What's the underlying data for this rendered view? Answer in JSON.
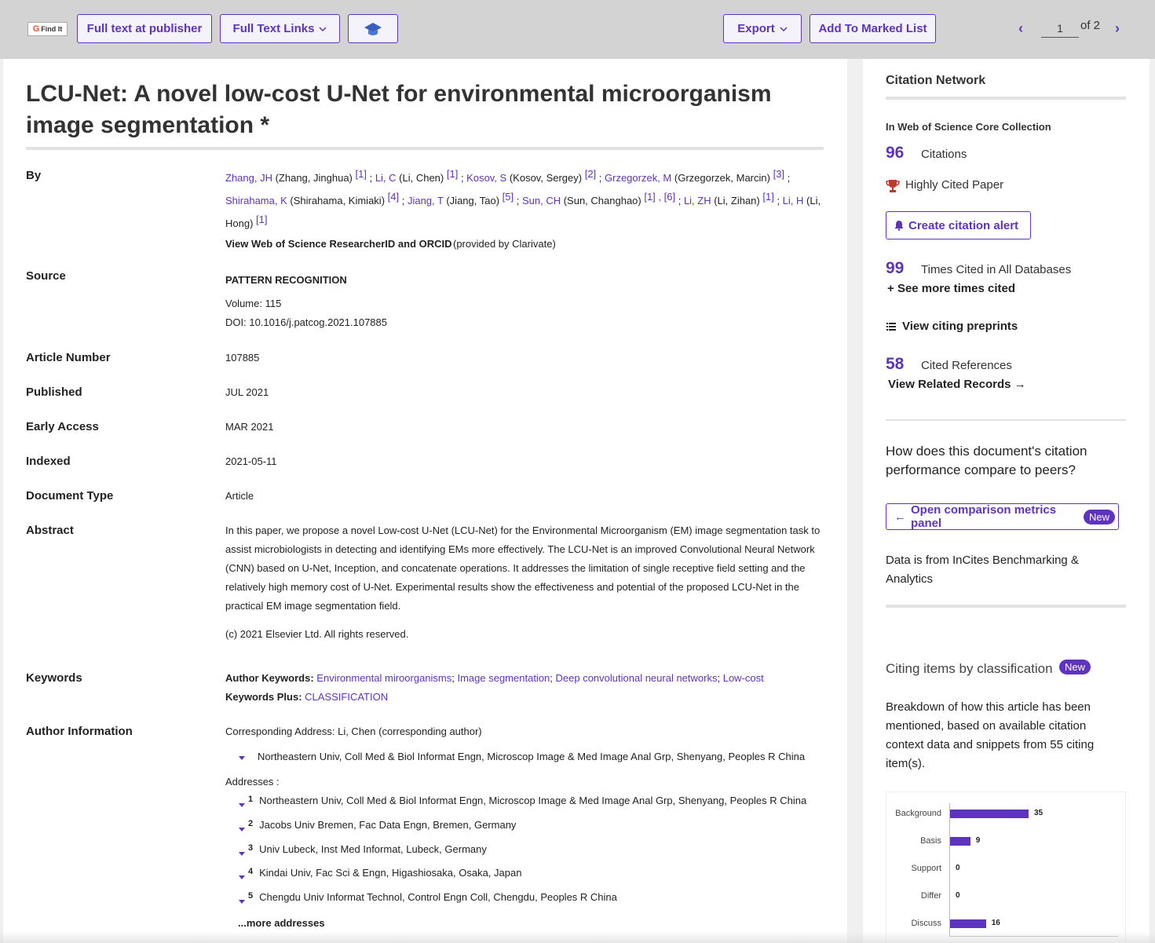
{
  "toolbar": {
    "findit": "Find It",
    "full_text_publisher": "Full text at publisher",
    "full_text_links": "Full Text Links",
    "export": "Export",
    "add_marked": "Add To Marked List",
    "page_current": "1",
    "page_total": "of 2"
  },
  "record": {
    "title": "LCU-Net: A novel low-cost U-Net for environmental microorganism image segmentation *",
    "labels": {
      "by": "By",
      "source": "Source",
      "article_number": "Article Number",
      "published": "Published",
      "early_access": "Early Access",
      "indexed": "Indexed",
      "document_type": "Document Type",
      "abstract": "Abstract",
      "keywords": "Keywords",
      "author_information": "Author Information"
    },
    "authors": [
      {
        "short": "Zhang, JH",
        "full": "(Zhang, Jinghua)",
        "refs": "[1]"
      },
      {
        "short": "Li, C",
        "full": "(Li, Chen)",
        "refs": "[1]"
      },
      {
        "short": "Kosov, S",
        "full": "(Kosov, Sergey)",
        "refs": "[2]"
      },
      {
        "short": "Grzegorzek, M",
        "full": "(Grzegorzek, Marcin)",
        "refs": "[3]"
      },
      {
        "short": "Shirahama, K",
        "full": "(Shirahama, Kimiaki)",
        "refs": "[4]"
      },
      {
        "short": "Jiang, T",
        "full": "(Jiang, Tao)",
        "refs": "[5]"
      },
      {
        "short": "Sun, CH",
        "full": "(Sun, Changhao)",
        "refs": "[1] , [6]"
      },
      {
        "short": "Li, ZH",
        "full": "(Li, Zihan)",
        "refs": "[1]"
      },
      {
        "short": "Li, H",
        "full": "(Li, Hong)",
        "refs": "[1]"
      }
    ],
    "researcher_link": "View Web of Science ResearcherID and ORCID",
    "provided_by": "(provided by Clarivate)",
    "source_journal": "PATTERN RECOGNITION",
    "volume": "Volume: 115",
    "doi": "DOI: 10.1016/j.patcog.2021.107885",
    "article_number": "107885",
    "published": "JUL 2021",
    "early_access": "MAR 2021",
    "indexed": "2021-05-11",
    "document_type": "Article",
    "abstract": "In this paper, we propose a novel Low-cost U-Net (LCU-Net) for the Environmental Microorganism (EM) image segmentation task to assist microbiologists in detecting and identifying EMs more effectively. The LCU-Net is an improved Convolutional Neural Network (CNN) based on U-Net, Inception, and concatenate operations. It addresses the limitation of single receptive field setting and the relatively high memory cost of U-Net. Experimental results show the effectiveness and potential of the proposed LCU-Net in the practical EM image segmentation field.",
    "copyright": "(c) 2021 Elsevier Ltd. All rights reserved.",
    "author_keywords_label": "Author Keywords:",
    "author_keywords": [
      "Environmental miroorganisms",
      "Image segmentation",
      "Deep convolutional neural networks",
      "Low-cost"
    ],
    "keywords_plus_label": "Keywords Plus:",
    "keywords_plus": "CLASSIFICATION",
    "corresponding": "Corresponding Address: Li, Chen  (corresponding author)",
    "corresponding_address": "Northeastern Univ, Coll Med & Biol Informat Engn, Microscop Image & Med Image Anal Grp, Shenyang, Peoples R China",
    "addresses_label": "Addresses :",
    "addresses": [
      {
        "n": "1",
        "text": "Northeastern Univ, Coll Med & Biol Informat Engn, Microscop Image & Med Image Anal Grp, Shenyang, Peoples R China"
      },
      {
        "n": "2",
        "text": "Jacobs Univ Bremen, Fac Data Engn, Bremen, Germany"
      },
      {
        "n": "3",
        "text": "Univ Lubeck, Inst Med Informat, Lubeck, Germany"
      },
      {
        "n": "4",
        "text": "Kindai Univ, Fac Sci & Engn, Higashiosaka, Osaka, Japan"
      },
      {
        "n": "5",
        "text": "Chengdu Univ Informat Technol, Control Engn Coll, Chengdu, Peoples R China"
      }
    ],
    "more_addresses": "...more addresses"
  },
  "sidebar": {
    "citation_network": "Citation Network",
    "core_collection": "In Web of Science Core Collection",
    "citations_count": "96",
    "citations_label": "Citations",
    "highly_cited": "Highly Cited Paper",
    "create_alert": "Create citation alert",
    "all_db_count": "99",
    "all_db_label": "Times Cited in All Databases",
    "see_more": "See more times cited",
    "view_preprints": "View citing preprints",
    "cited_refs_count": "58",
    "cited_refs_label": "Cited References",
    "view_related": "View Related Records",
    "compare_question": "How does this document's citation performance compare to peers?",
    "open_comparison": "Open comparison metrics panel",
    "new_badge": "New",
    "incites_note": "Data is from InCites Benchmarking & Analytics",
    "citing_items_title": "Citing items by classification",
    "breakdown_text": "Breakdown of how this article has been mentioned, based on available citation context data and snippets from 55 citing item(s)."
  },
  "chart_data": {
    "type": "bar",
    "orientation": "horizontal",
    "categories": [
      "Background",
      "Basis",
      "Support",
      "Differ",
      "Discuss"
    ],
    "values": [
      35,
      9,
      0,
      0,
      16
    ]
  },
  "colors": {
    "accent": "#5e33bf",
    "toolbar_bg": "#d3d3d3",
    "trophy": "#c0392b"
  }
}
